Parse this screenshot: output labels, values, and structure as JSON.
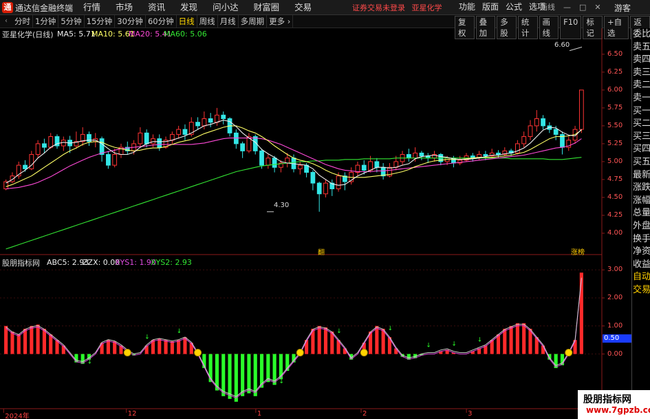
{
  "window": {
    "logo": "通",
    "title": "通达信金融终端",
    "menu": [
      "行情",
      "市场",
      "资讯",
      "发现",
      "问小达",
      "财富圈",
      "交易"
    ],
    "promo": [
      "证券交易未登录",
      "亚星化学"
    ],
    "right_menu": [
      "功能",
      "版面",
      "公式",
      "选项"
    ],
    "controls": [
      "画线",
      "—",
      "□",
      "✕"
    ],
    "guest": "游客"
  },
  "toolbar": {
    "nav_arrow": "‹",
    "periods": [
      "分时",
      "1分钟",
      "5分钟",
      "15分钟",
      "30分钟",
      "60分钟",
      "日线",
      "周线",
      "月线",
      "多周期",
      "更多 ›"
    ],
    "active_period": "日线",
    "buttons": [
      "复权",
      "叠加",
      "多股",
      "统计",
      "画线",
      "F10",
      "标记",
      "+自选",
      "返回"
    ]
  },
  "main_chart": {
    "stock_title": "亚星化学(日线)",
    "ma5": "MA5: 5.71",
    "ma10": "MA10: 5.61",
    "ma20": "MA20: 5.41",
    "ma60": "MA60: 5.06",
    "high_label": "6.60",
    "low_label": "4.30",
    "tag_mid": "翻",
    "tag_right": "涨榜",
    "y_axis": [
      "6.50",
      "6.25",
      "6.00",
      "5.75",
      "5.50",
      "5.25",
      "5.00",
      "4.75",
      "4.50",
      "4.25",
      "4.00"
    ]
  },
  "indicator": {
    "title": "股朋指标网",
    "abc5": "ABC5: 2.93",
    "zzx": "ZZX: 0.00",
    "xys1": "XYS1: 1.90",
    "xys2": "XYS2: 2.93",
    "y_axis": [
      "3.00",
      "2.00",
      "1.00",
      "0.00"
    ],
    "cursor_value": "0.50"
  },
  "dates": [
    "2024年",
    "12",
    "1",
    "2",
    "3"
  ],
  "right_panel": [
    "委比",
    "卖五",
    "卖四",
    "卖三",
    "卖二",
    "卖一",
    "买一",
    "买二",
    "买三",
    "买四",
    "买五",
    "最新",
    "涨跌",
    "涨幅",
    "总量",
    "外盘",
    "换手",
    "净资",
    "收益",
    "",
    "自动",
    "交易"
  ],
  "watermark": {
    "cn": "股朋指标网",
    "url": "www.7gpzb.com"
  },
  "colors": {
    "up": "#ff3333",
    "down": "#33e6e6",
    "ma5": "#eeeeee",
    "ma10": "#ffff66",
    "ma20": "#ff4ad8",
    "ma60": "#33e633"
  },
  "chart_data": {
    "type": "candlestick",
    "title": "亚星化学(日线)",
    "ylim": [
      3.75,
      6.7
    ],
    "candles": [
      [
        4.62,
        4.72,
        4.6,
        4.75
      ],
      [
        4.72,
        4.8,
        4.7,
        4.85
      ],
      [
        4.8,
        4.95,
        4.76,
        5.0
      ],
      [
        4.95,
        4.9,
        4.86,
        5.02
      ],
      [
        4.9,
        5.1,
        4.88,
        5.15
      ],
      [
        5.1,
        5.25,
        5.05,
        5.3
      ],
      [
        5.25,
        5.2,
        5.12,
        5.32
      ],
      [
        5.2,
        5.35,
        5.18,
        5.4
      ],
      [
        5.35,
        5.22,
        5.18,
        5.38
      ],
      [
        5.22,
        5.3,
        5.15,
        5.35
      ],
      [
        5.3,
        5.22,
        5.12,
        5.36
      ],
      [
        5.22,
        5.28,
        5.18,
        5.42
      ],
      [
        5.28,
        5.38,
        5.22,
        5.48
      ],
      [
        5.38,
        5.28,
        5.22,
        5.42
      ],
      [
        5.28,
        5.32,
        5.2,
        5.4
      ],
      [
        5.32,
        5.1,
        5.0,
        5.35
      ],
      [
        5.1,
        4.95,
        4.9,
        5.15
      ],
      [
        4.95,
        5.1,
        4.92,
        5.18
      ],
      [
        5.1,
        5.2,
        5.05,
        5.25
      ],
      [
        5.2,
        5.15,
        5.1,
        5.28
      ],
      [
        5.15,
        5.25,
        5.1,
        5.3
      ],
      [
        5.25,
        5.4,
        5.2,
        5.48
      ],
      [
        5.4,
        5.25,
        5.2,
        5.45
      ],
      [
        5.25,
        5.32,
        5.2,
        5.38
      ],
      [
        5.32,
        5.2,
        5.15,
        5.38
      ],
      [
        5.2,
        5.3,
        5.18,
        5.35
      ],
      [
        5.3,
        5.38,
        5.25,
        5.42
      ],
      [
        5.38,
        5.45,
        5.32,
        5.5
      ],
      [
        5.45,
        5.38,
        5.3,
        5.52
      ],
      [
        5.38,
        5.55,
        5.35,
        5.62
      ],
      [
        5.55,
        5.5,
        5.45,
        5.62
      ],
      [
        5.5,
        5.6,
        5.45,
        5.7
      ],
      [
        5.6,
        5.55,
        5.48,
        5.68
      ],
      [
        5.55,
        5.65,
        5.5,
        5.75
      ],
      [
        5.65,
        5.6,
        5.52,
        5.7
      ],
      [
        5.6,
        5.4,
        5.35,
        5.62
      ],
      [
        5.4,
        5.25,
        5.18,
        5.45
      ],
      [
        5.25,
        5.15,
        5.05,
        5.28
      ],
      [
        5.15,
        5.35,
        5.12,
        5.4
      ],
      [
        5.35,
        5.15,
        5.1,
        5.38
      ],
      [
        5.15,
        4.95,
        4.9,
        5.18
      ],
      [
        4.95,
        5.05,
        4.9,
        5.1
      ],
      [
        5.05,
        4.92,
        4.85,
        5.08
      ],
      [
        4.92,
        4.98,
        4.85,
        5.02
      ],
      [
        4.98,
        5.05,
        4.92,
        5.12
      ],
      [
        5.05,
        4.9,
        4.85,
        5.1
      ],
      [
        4.9,
        4.95,
        4.82,
        5.0
      ],
      [
        4.95,
        4.85,
        4.78,
        4.98
      ],
      [
        4.85,
        4.7,
        4.6,
        4.88
      ],
      [
        4.7,
        4.55,
        4.3,
        4.72
      ],
      [
        4.55,
        4.7,
        4.5,
        4.75
      ],
      [
        4.7,
        4.62,
        4.52,
        4.75
      ],
      [
        4.62,
        4.8,
        4.58,
        4.85
      ],
      [
        4.8,
        4.72,
        4.6,
        4.85
      ],
      [
        4.72,
        4.85,
        4.68,
        4.92
      ],
      [
        4.85,
        4.95,
        4.8,
        5.0
      ],
      [
        4.95,
        4.88,
        4.82,
        5.02
      ],
      [
        4.88,
        5.0,
        4.85,
        5.08
      ],
      [
        5.0,
        4.92,
        4.85,
        5.05
      ],
      [
        4.92,
        4.8,
        4.75,
        4.98
      ],
      [
        4.8,
        4.92,
        4.78,
        4.98
      ],
      [
        4.92,
        5.0,
        4.88,
        5.08
      ],
      [
        5.0,
        5.1,
        4.95,
        5.15
      ],
      [
        5.1,
        5.05,
        5.0,
        5.18
      ],
      [
        5.05,
        5.12,
        5.0,
        5.2
      ],
      [
        5.12,
        5.08,
        5.02,
        5.15
      ],
      [
        5.08,
        5.05,
        4.98,
        5.12
      ],
      [
        5.05,
        5.1,
        5.0,
        5.15
      ],
      [
        5.1,
        5.0,
        4.95,
        5.12
      ],
      [
        5.0,
        5.05,
        4.95,
        5.08
      ],
      [
        5.05,
        4.98,
        4.92,
        5.08
      ],
      [
        4.98,
        5.02,
        4.95,
        5.08
      ],
      [
        5.02,
        5.08,
        5.0,
        5.12
      ],
      [
        5.08,
        5.05,
        5.0,
        5.12
      ],
      [
        5.05,
        5.1,
        5.02,
        5.15
      ],
      [
        5.1,
        5.08,
        5.02,
        5.15
      ],
      [
        5.08,
        5.12,
        5.05,
        5.18
      ],
      [
        5.12,
        5.1,
        5.05,
        5.16
      ],
      [
        5.1,
        5.15,
        5.08,
        5.2
      ],
      [
        5.15,
        5.12,
        5.08,
        5.18
      ],
      [
        5.12,
        5.25,
        5.1,
        5.3
      ],
      [
        5.25,
        5.35,
        5.2,
        5.42
      ],
      [
        5.35,
        5.5,
        5.3,
        5.58
      ],
      [
        5.5,
        5.6,
        5.42,
        5.72
      ],
      [
        5.6,
        5.5,
        5.45,
        5.65
      ],
      [
        5.5,
        5.45,
        5.4,
        5.55
      ],
      [
        5.45,
        5.38,
        5.3,
        5.5
      ],
      [
        5.38,
        5.2,
        5.1,
        5.42
      ],
      [
        5.2,
        5.3,
        5.15,
        5.35
      ],
      [
        5.3,
        5.45,
        5.25,
        5.5
      ],
      [
        5.45,
        6.0,
        5.4,
        6.0
      ]
    ],
    "ma5": [
      4.7,
      4.75,
      4.82,
      4.88,
      4.95,
      5.05,
      5.12,
      5.2,
      5.25,
      5.27,
      5.26,
      5.27,
      5.29,
      5.3,
      5.3,
      5.25,
      5.18,
      5.12,
      5.1,
      5.1,
      5.13,
      5.2,
      5.25,
      5.28,
      5.28,
      5.28,
      5.3,
      5.33,
      5.36,
      5.4,
      5.45,
      5.5,
      5.52,
      5.55,
      5.58,
      5.56,
      5.49,
      5.4,
      5.33,
      5.27,
      5.17,
      5.11,
      5.06,
      5.0,
      4.98,
      4.97,
      4.96,
      4.95,
      4.9,
      4.81,
      4.75,
      4.69,
      4.67,
      4.68,
      4.74,
      4.8,
      4.84,
      4.88,
      4.92,
      4.92,
      4.91,
      4.92,
      4.95,
      4.97,
      5.04,
      5.07,
      5.08,
      5.09,
      5.07,
      5.06,
      5.04,
      5.03,
      5.03,
      5.04,
      5.05,
      5.07,
      5.09,
      5.09,
      5.11,
      5.12,
      5.15,
      5.19,
      5.26,
      5.35,
      5.44,
      5.48,
      5.47,
      5.41,
      5.37,
      5.36,
      5.45
    ],
    "ma10": [
      4.65,
      4.68,
      4.72,
      4.76,
      4.8,
      4.86,
      4.92,
      4.98,
      5.04,
      5.1,
      5.15,
      5.19,
      5.24,
      5.27,
      5.28,
      5.27,
      5.23,
      5.2,
      5.18,
      5.16,
      5.15,
      5.16,
      5.18,
      5.19,
      5.19,
      5.21,
      5.24,
      5.27,
      5.29,
      5.31,
      5.35,
      5.39,
      5.42,
      5.45,
      5.48,
      5.5,
      5.5,
      5.47,
      5.43,
      5.4,
      5.35,
      5.29,
      5.22,
      5.16,
      5.1,
      5.05,
      5.02,
      5.0,
      4.97,
      4.93,
      4.88,
      4.84,
      4.81,
      4.79,
      4.78,
      4.78,
      4.78,
      4.79,
      4.8,
      4.81,
      4.82,
      4.84,
      4.86,
      4.89,
      4.93,
      4.96,
      4.99,
      5.01,
      5.02,
      5.03,
      5.03,
      5.03,
      5.04,
      5.05,
      5.06,
      5.06,
      5.06,
      5.07,
      5.08,
      5.09,
      5.11,
      5.13,
      5.17,
      5.22,
      5.27,
      5.32,
      5.35,
      5.35,
      5.36,
      5.38,
      5.44
    ],
    "ma20": [
      4.62,
      4.63,
      4.64,
      4.66,
      4.68,
      4.71,
      4.75,
      4.79,
      4.84,
      4.89,
      4.94,
      4.98,
      5.02,
      5.06,
      5.09,
      5.12,
      5.14,
      5.16,
      5.18,
      5.19,
      5.2,
      5.21,
      5.22,
      5.23,
      5.24,
      5.24,
      5.24,
      5.24,
      5.24,
      5.24,
      5.25,
      5.26,
      5.28,
      5.3,
      5.32,
      5.33,
      5.33,
      5.33,
      5.33,
      5.33,
      5.32,
      5.3,
      5.27,
      5.24,
      5.2,
      5.16,
      5.12,
      5.08,
      5.04,
      5.0,
      4.96,
      4.93,
      4.9,
      4.88,
      4.87,
      4.86,
      4.86,
      4.86,
      4.87,
      4.87,
      4.88,
      4.89,
      4.9,
      4.91,
      4.92,
      4.93,
      4.94,
      4.95,
      4.96,
      4.97,
      4.98,
      4.99,
      5.0,
      5.01,
      5.02,
      5.03,
      5.04,
      5.05,
      5.06,
      5.07,
      5.08,
      5.09,
      5.11,
      5.13,
      5.15,
      5.17,
      5.19,
      5.2,
      5.22,
      5.26,
      5.32
    ],
    "ma60": [
      3.78,
      3.81,
      3.84,
      3.87,
      3.9,
      3.93,
      3.96,
      3.99,
      4.02,
      4.05,
      4.08,
      4.11,
      4.14,
      4.17,
      4.2,
      4.23,
      4.26,
      4.29,
      4.32,
      4.35,
      4.38,
      4.41,
      4.44,
      4.47,
      4.5,
      4.53,
      4.56,
      4.59,
      4.62,
      4.65,
      4.68,
      4.71,
      4.74,
      4.77,
      4.8,
      4.83,
      4.86,
      4.88,
      4.9,
      4.92,
      4.94,
      4.95,
      4.96,
      4.97,
      4.98,
      4.99,
      5.0,
      5.0,
      5.01,
      5.01,
      5.02,
      5.02,
      5.02,
      5.03,
      5.03,
      5.03,
      5.04,
      5.04,
      5.04,
      5.04,
      5.04,
      5.05,
      5.05,
      5.05,
      5.05,
      5.05,
      5.05,
      5.05,
      5.05,
      5.05,
      5.05,
      5.05,
      5.05,
      5.05,
      5.05,
      5.05,
      5.05,
      5.05,
      5.05,
      5.04,
      5.04,
      5.04,
      5.04,
      5.04,
      5.04,
      5.03,
      5.03,
      5.03,
      5.04,
      5.05,
      5.06
    ],
    "indicator_series": [
      1.0,
      0.8,
      0.7,
      0.9,
      1.0,
      1.05,
      0.9,
      0.7,
      0.5,
      0.3,
      0.0,
      -0.3,
      -0.35,
      -0.2,
      0.0,
      0.4,
      0.5,
      0.45,
      0.3,
      0.1,
      -0.05,
      0.0,
      0.3,
      0.5,
      0.55,
      0.5,
      0.45,
      0.5,
      0.6,
      0.4,
      0.0,
      -0.5,
      -1.0,
      -1.3,
      -1.5,
      -1.6,
      -1.7,
      -1.5,
      -1.4,
      -1.5,
      -1.2,
      -1.0,
      -1.1,
      -0.9,
      -0.6,
      -0.3,
      0.0,
      0.5,
      0.9,
      1.0,
      0.95,
      0.8,
      0.5,
      0.2,
      -0.2,
      0.0,
      0.4,
      0.8,
      1.0,
      0.9,
      0.6,
      0.2,
      -0.1,
      -0.2,
      -0.15,
      -0.05,
      0.0,
      0.0,
      0.1,
      0.15,
      0.05,
      0.0,
      0.0,
      0.1,
      0.2,
      0.3,
      0.5,
      0.7,
      0.9,
      1.0,
      1.1,
      1.1,
      0.9,
      0.6,
      0.3,
      -0.2,
      -0.5,
      -0.4,
      0.0,
      0.5,
      2.9
    ]
  }
}
